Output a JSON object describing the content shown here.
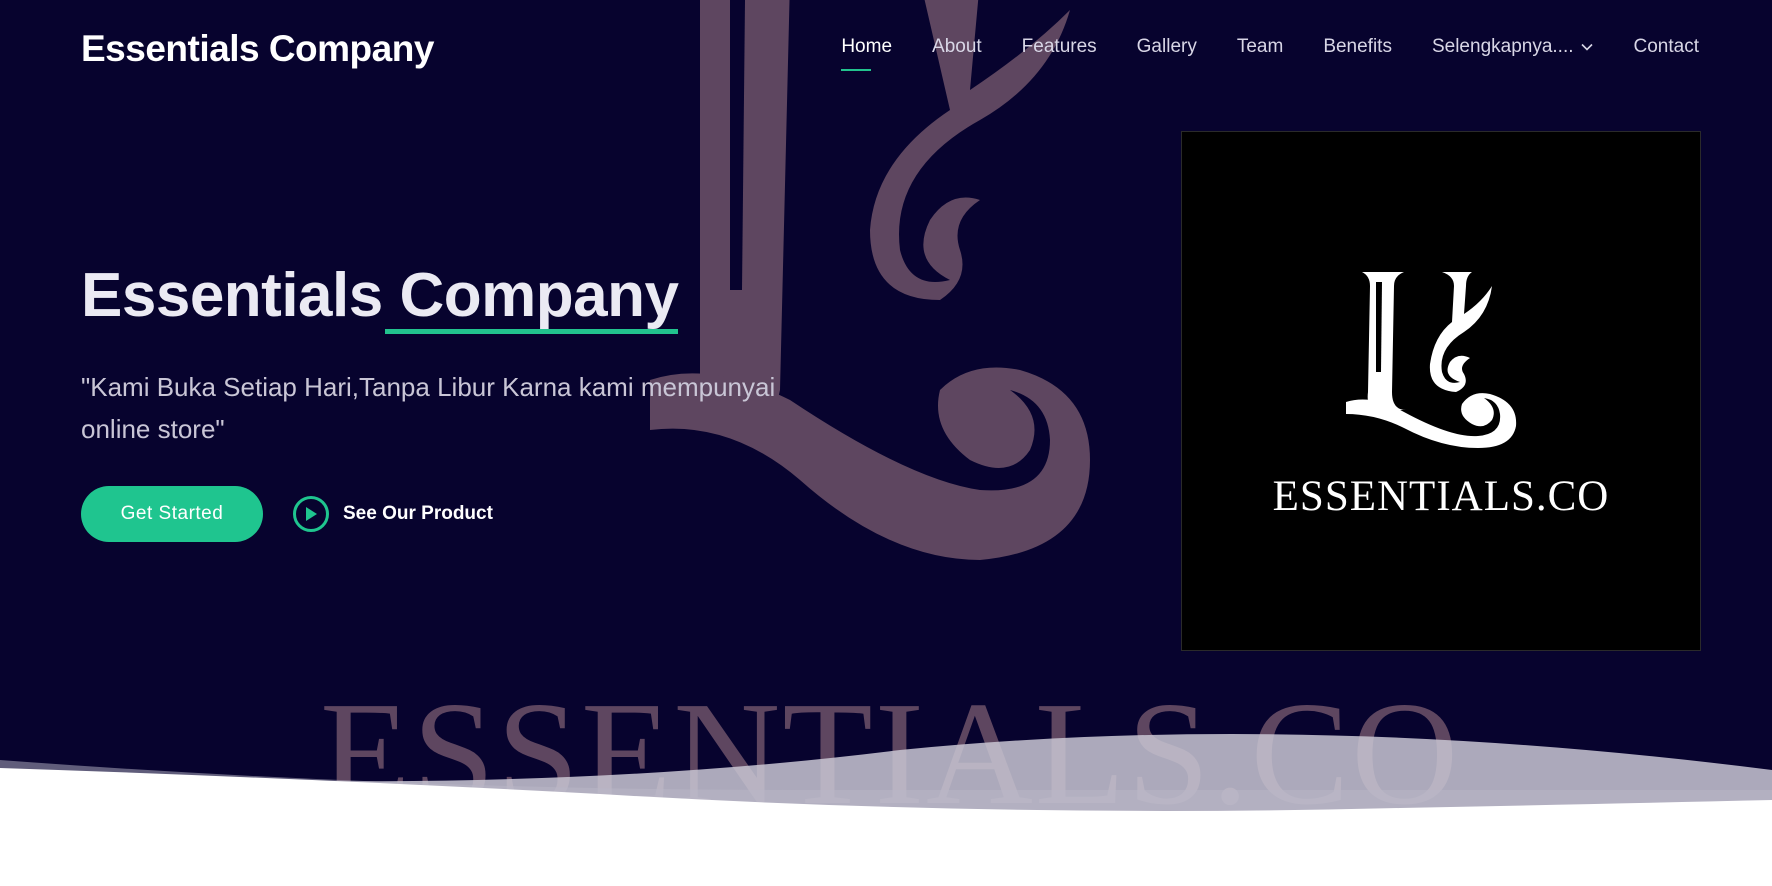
{
  "header": {
    "brand": "Essentials Company",
    "nav": [
      {
        "label": "Home",
        "active": true
      },
      {
        "label": "About"
      },
      {
        "label": "Features"
      },
      {
        "label": "Gallery"
      },
      {
        "label": "Team"
      },
      {
        "label": "Benefits"
      },
      {
        "label": "Selengkapnya....",
        "icon": "chevron-down-icon"
      },
      {
        "label": "Contact"
      }
    ]
  },
  "hero": {
    "title_part1": "Essentials",
    "title_part2": "Company",
    "subtitle": "\"Kami Buka Setiap Hari,Tanpa Libur Karna kami mempunyai online store\"",
    "primary_button": "Get Started",
    "secondary_button": "See Our Product",
    "secondary_icon": "play-icon",
    "logo_text": "ESSENTIALS.CO",
    "watermark_text": "ESSENTIALS.CO"
  },
  "colors": {
    "hero_background": "#07032e",
    "accent": "#1fc58f",
    "watermark": "#5e4660"
  }
}
